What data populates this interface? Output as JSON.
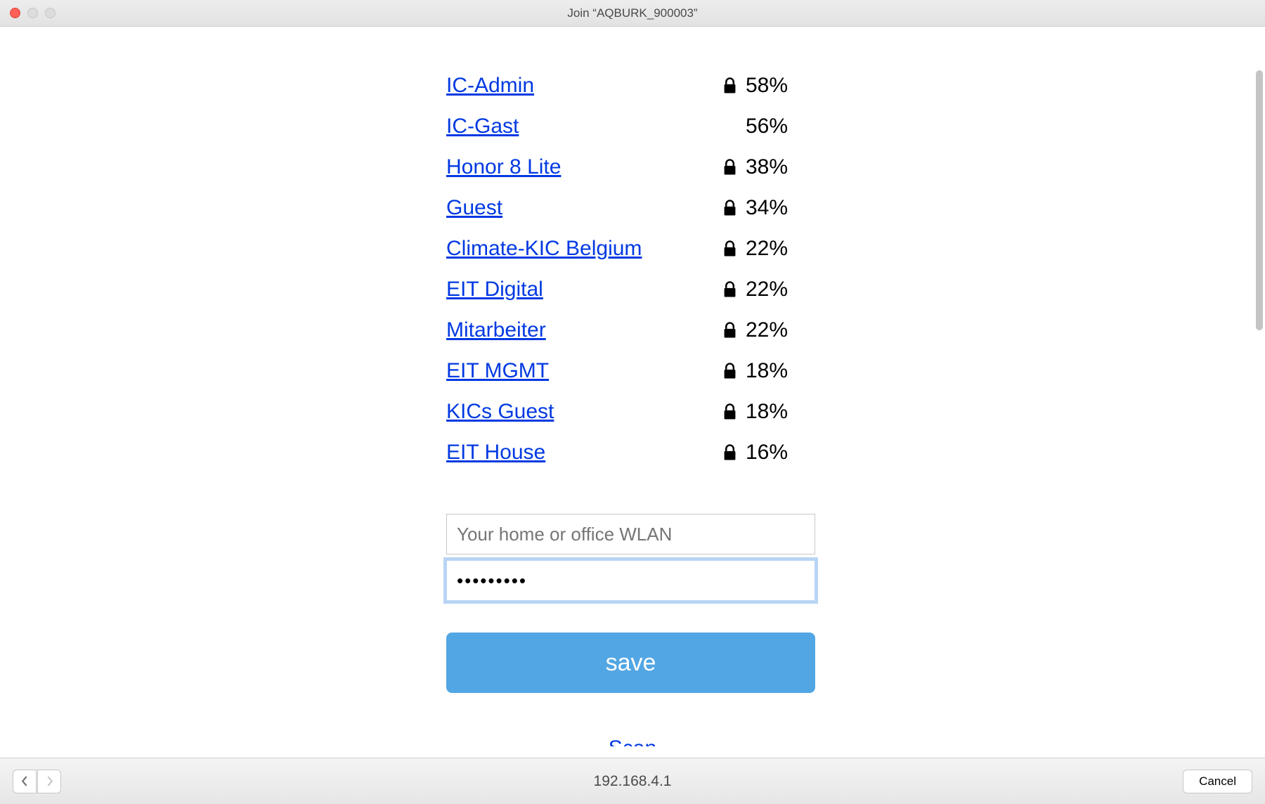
{
  "window": {
    "title": "Join “AQBURK_900003”"
  },
  "networks": [
    {
      "name": "IC-Admin",
      "secured": true,
      "signal": "58%"
    },
    {
      "name": "IC-Gast",
      "secured": false,
      "signal": "56%"
    },
    {
      "name": "Honor 8 Lite",
      "secured": true,
      "signal": "38%"
    },
    {
      "name": "Guest",
      "secured": true,
      "signal": "34%"
    },
    {
      "name": "Climate-KIC Belgium",
      "secured": true,
      "signal": "22%"
    },
    {
      "name": "EIT Digital",
      "secured": true,
      "signal": "22%"
    },
    {
      "name": "Mitarbeiter",
      "secured": true,
      "signal": "22%"
    },
    {
      "name": "EIT MGMT",
      "secured": true,
      "signal": "18%"
    },
    {
      "name": "KICs Guest",
      "secured": true,
      "signal": "18%"
    },
    {
      "name": "EIT House",
      "secured": true,
      "signal": "16%"
    }
  ],
  "form": {
    "ssid_placeholder": "Your home or office WLAN",
    "ssid_value": "",
    "password_value": "•••••••••",
    "save_label": "save",
    "scan_label": "Scan"
  },
  "footer": {
    "address": "192.168.4.1",
    "cancel_label": "Cancel"
  }
}
